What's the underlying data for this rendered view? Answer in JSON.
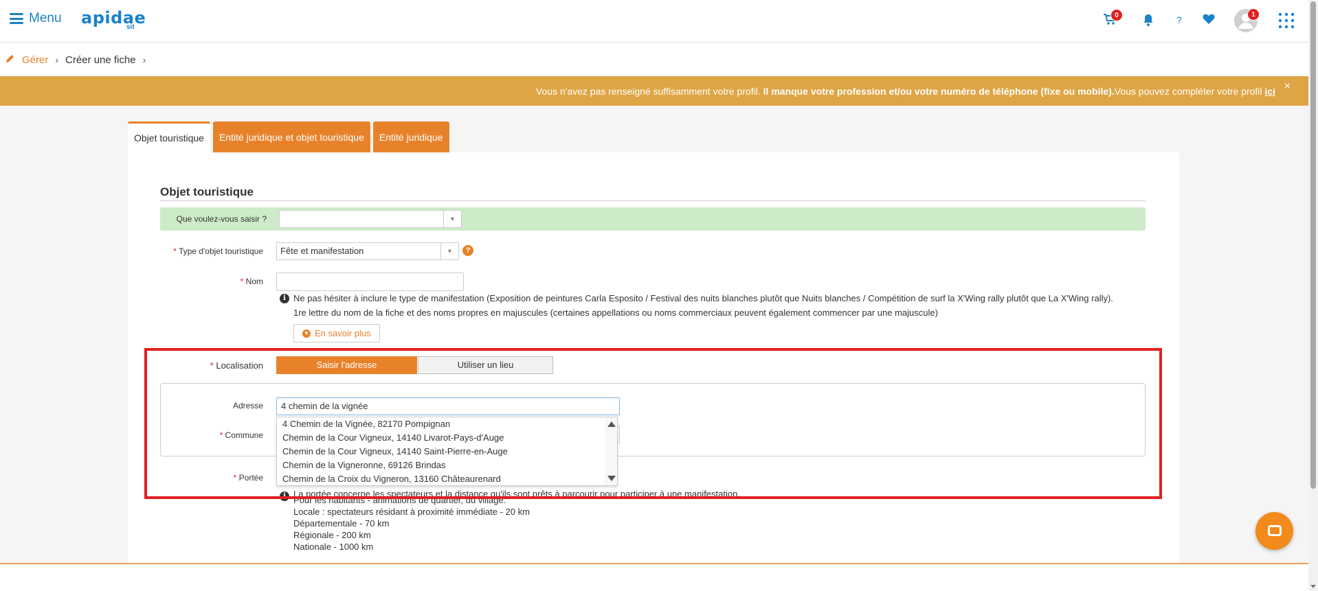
{
  "header": {
    "menu_label": "Menu",
    "logo_text": "apidae",
    "logo_sub": "sit",
    "cart_count": "0",
    "help_label": "?",
    "profile_count": "1"
  },
  "breadcrumb": {
    "item1": "Gérer",
    "item2": "Créer une fiche"
  },
  "banner": {
    "text_start": "Vous n'avez pas renseigné suffisamment votre profil.",
    "text_bold": "Il manque votre profession et/ou votre numéro de téléphone (fixe ou mobile).",
    "text_end": "Vous pouvez compléter votre profil",
    "link": "ici",
    "close": "×"
  },
  "tabs": [
    {
      "label": "Objet touristique"
    },
    {
      "label": "Entité juridique et objet touristique"
    },
    {
      "label": "Entité juridique"
    }
  ],
  "form": {
    "section_title": "Objet touristique",
    "que_saisir_label": "Que voulez-vous saisir ?",
    "que_saisir_value": "",
    "type_label": "Type d'objet touristique",
    "type_value": "Fête et manifestation",
    "nom_label": "Nom",
    "nom_value": "",
    "nom_hint_1": "Ne pas hésiter à inclure le type de manifestation (Exposition de peintures Carla Esposito / Festival des nuits blanches plutôt que Nuits blanches / Compétition de surf la X'Wing rally plutôt que La X'Wing rally).",
    "nom_hint_2": "1re lettre du nom de la fiche et des noms propres en majuscules (certaines appellations ou noms commerciaux peuvent également commencer par une majuscule)",
    "more_label": "En savoir plus",
    "localisation_label": "Localisation",
    "loc_option_address": "Saisir l'adresse",
    "loc_option_place": "Utiliser un lieu",
    "adresse_label": "Adresse",
    "adresse_value": "4 chemin de la vignée",
    "commune_label": "Commune",
    "portee_label": "Portée",
    "portee_intro": "La portée concerne les spectateurs et la distance qu'ils sont prêts à parcourir pour participer à une manifestation.",
    "portee_lines": [
      "Pour les habitants - animations de quartier, du village.",
      "Locale : spectateurs résidant à proximité immédiate - 20 km",
      "Départementale - 70 km",
      "Régionale - 200 km",
      "Nationale - 1000 km"
    ]
  },
  "suggestions": [
    "4 Chemin de la Vignée, 82170 Pompignan",
    "Chemin de la Cour Vigneux, 14140 Livarot-Pays-d'Auge",
    "Chemin de la Cour Vigneux, 14140 Saint-Pierre-en-Auge",
    "Chemin de la Vigneronne, 69126 Brindas",
    "Chemin de la Croix du Vigneron, 13160 Châteaurenard"
  ],
  "icons": {
    "menu": "hamburger-icon",
    "cart": "cart-icon",
    "bell": "bell-icon",
    "heart": "heart-icon",
    "apps": "grid-icon",
    "chat": "chat-icon"
  },
  "colors": {
    "brand_blue": "#1a82c9",
    "accent_orange": "#e8822a",
    "banner": "#dfa545",
    "green_row": "#cdebc8",
    "highlight_red": "#e02020"
  }
}
